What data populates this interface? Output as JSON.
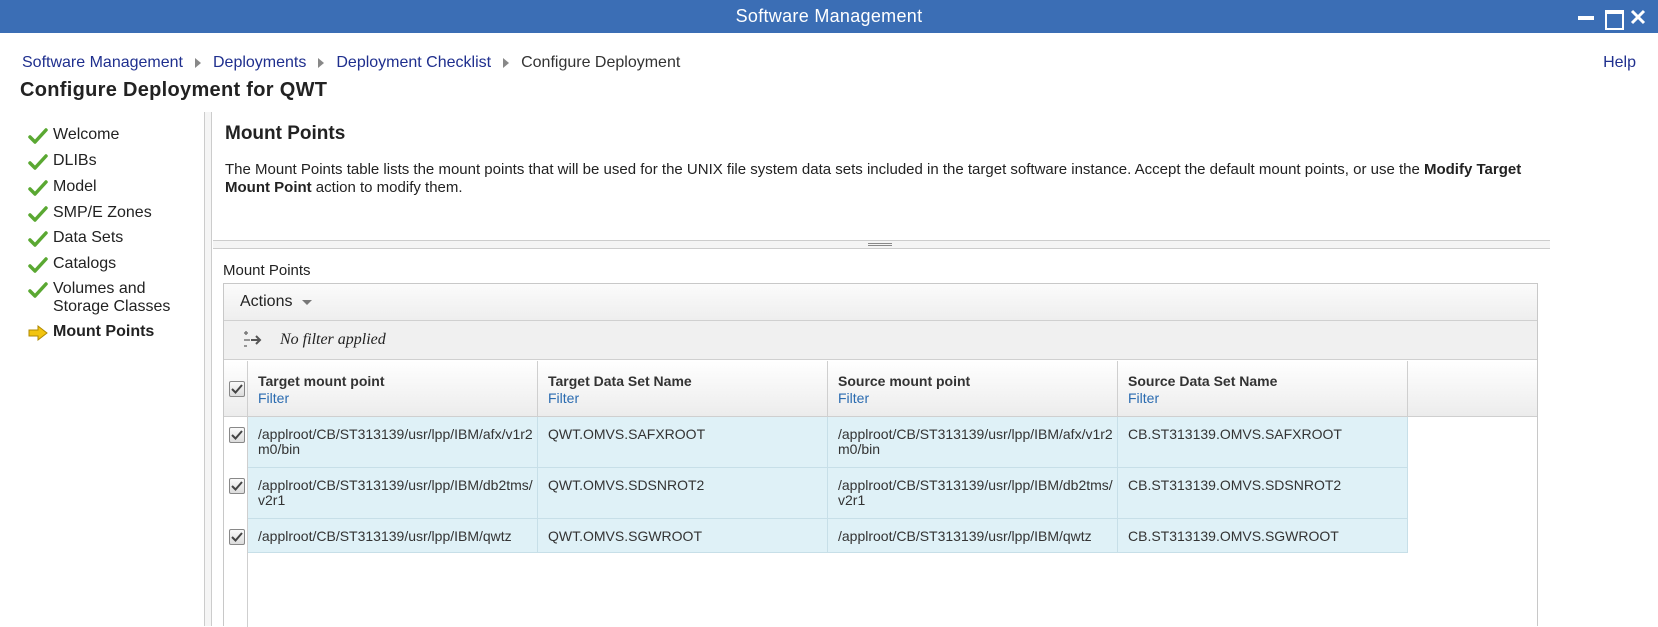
{
  "window": {
    "title": "Software Management"
  },
  "breadcrumb": {
    "items": [
      "Software Management",
      "Deployments",
      "Deployment Checklist"
    ],
    "current": "Configure Deployment"
  },
  "help_label": "Help",
  "page_title": "Configure Deployment for QWT",
  "nav": {
    "items": [
      {
        "label": "Welcome",
        "status": "complete"
      },
      {
        "label": "DLIBs",
        "status": "complete"
      },
      {
        "label": "Model",
        "status": "complete"
      },
      {
        "label": "SMP/E Zones",
        "status": "complete"
      },
      {
        "label": "Data Sets",
        "status": "complete"
      },
      {
        "label": "Catalogs",
        "status": "complete"
      },
      {
        "label": "Volumes and Storage Classes",
        "status": "complete"
      },
      {
        "label": "Mount Points",
        "status": "current"
      }
    ]
  },
  "section": {
    "title": "Mount Points",
    "description_part1": "The Mount Points table lists the mount points that will be used for the UNIX file system data sets included in the target software instance.  Accept the default mount points, or use the ",
    "description_bold": "Modify Target Mount Point",
    "description_part2": " action to modify them."
  },
  "table": {
    "caption": "Mount Points",
    "actions_label": "Actions",
    "filter_status": "No filter applied",
    "filter_link": "Filter",
    "columns": [
      "Target mount point",
      "Target Data Set Name",
      "Source mount point",
      "Source Data Set Name"
    ],
    "rows": [
      [
        "/applroot/CB/ST313139/usr/lpp/IBM/afx/v1r2m0/bin",
        "QWT.OMVS.SAFXROOT",
        "/applroot/CB/ST313139/usr/lpp/IBM/afx/v1r2m0/bin",
        "CB.ST313139.OMVS.SAFXROOT"
      ],
      [
        "/applroot/CB/ST313139/usr/lpp/IBM/db2tms/v2r1",
        "QWT.OMVS.SDSNROT2",
        "/applroot/CB/ST313139/usr/lpp/IBM/db2tms/v2r1",
        "CB.ST313139.OMVS.SDSNROT2"
      ],
      [
        "/applroot/CB/ST313139/usr/lpp/IBM/qwtz",
        "QWT.OMVS.SGWROOT",
        "/applroot/CB/ST313139/usr/lpp/IBM/qwtz",
        "CB.ST313139.OMVS.SGWROOT"
      ]
    ],
    "all_selected": true
  },
  "colors": {
    "titlebar": "#3b6eb5",
    "link": "#1f2f8e",
    "row_selected": "#dff1f7",
    "check_green": "#5aa832",
    "arrow_yellow": "#f2c40f"
  }
}
